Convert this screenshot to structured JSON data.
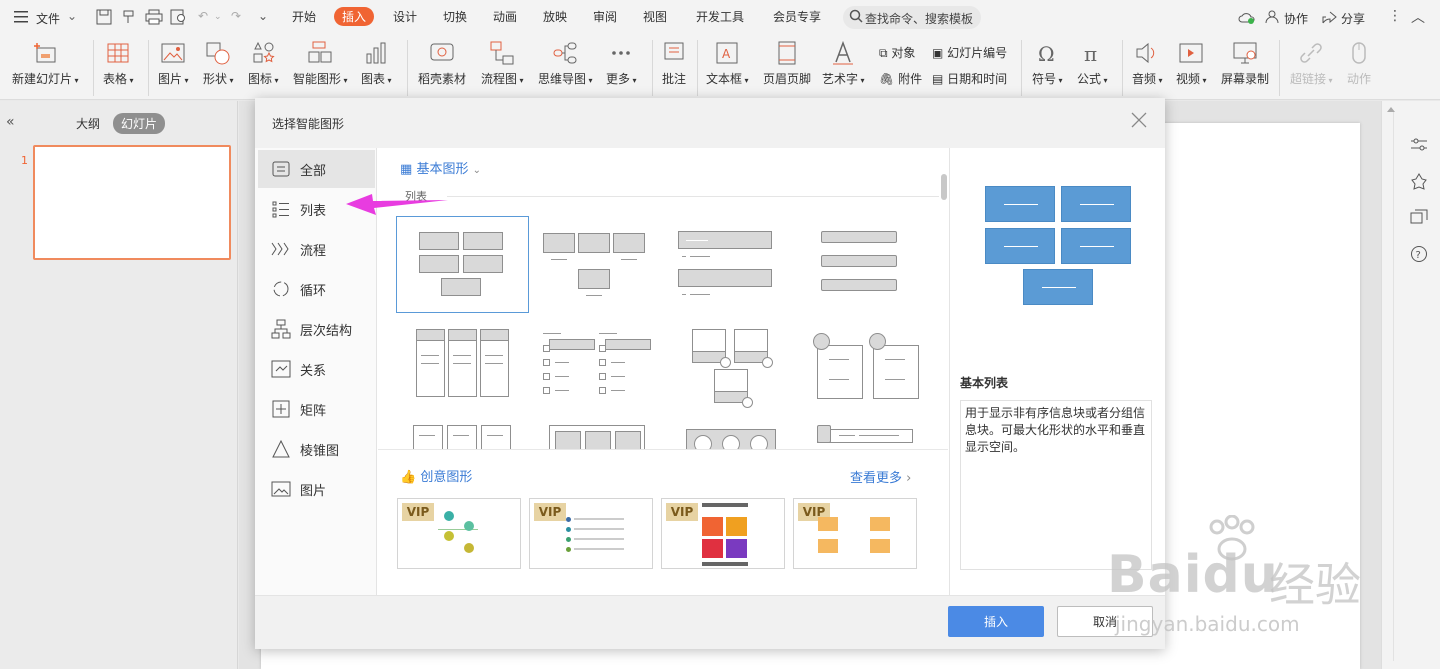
{
  "menu": {
    "file": "文件",
    "tabs": [
      "开始",
      "插入",
      "设计",
      "切换",
      "动画",
      "放映",
      "审阅",
      "视图",
      "开发工具",
      "会员专享"
    ],
    "active_tab": "插入",
    "search_placeholder": "查找命令、搜索模板",
    "collab": "协作",
    "share": "分享"
  },
  "ribbon": {
    "new_slide": "新建幻灯片",
    "table": "表格",
    "picture": "图片",
    "shape": "形状",
    "icon": "图标",
    "smart_art": "智能图形",
    "chart": "图表",
    "docer": "稻壳素材",
    "flowchart": "流程图",
    "mindmap": "思维导图",
    "more": "更多",
    "comment": "批注",
    "textbox": "文本框",
    "header_footer": "页眉页脚",
    "wordart": "艺术字",
    "object": "对象",
    "attachment": "附件",
    "slide_number": "幻灯片编号",
    "datetime": "日期和时间",
    "symbol": "符号",
    "formula": "公式",
    "audio": "音频",
    "video": "视频",
    "screen_rec": "屏幕录制",
    "hyperlink": "超链接",
    "action": "动作"
  },
  "left_panel": {
    "outline": "大纲",
    "slides": "幻灯片",
    "slide_no": "1"
  },
  "dialog": {
    "title": "选择智能图形",
    "categories": [
      {
        "label": "全部",
        "icon": "all-icon"
      },
      {
        "label": "列表",
        "icon": "list-icon"
      },
      {
        "label": "流程",
        "icon": "process-icon"
      },
      {
        "label": "循环",
        "icon": "cycle-icon"
      },
      {
        "label": "层次结构",
        "icon": "hierarchy-icon"
      },
      {
        "label": "关系",
        "icon": "relation-icon"
      },
      {
        "label": "矩阵",
        "icon": "matrix-icon"
      },
      {
        "label": "棱锥图",
        "icon": "pyramid-icon"
      },
      {
        "label": "图片",
        "icon": "picture-icon"
      }
    ],
    "active_category": "全部",
    "basic_shapes_label": "基本图形",
    "section_label": "列表",
    "creative_label": "创意图形",
    "see_more": "查看更多",
    "vip_badge": "VIP",
    "preview_title": "基本列表",
    "preview_desc": "用于显示非有序信息块或者分组信息块。可最大化形状的水平和垂直显示空间。",
    "insert_btn": "插入",
    "cancel_btn": "取消"
  },
  "watermark": {
    "text1": "Baidu",
    "text2": "经验",
    "url": "jingyan.baidu.com"
  },
  "colors": {
    "accent": "#f06433",
    "primary_btn": "#4b8ae5",
    "arrow": "#e83ce0",
    "preview_box": "#5b9bd5"
  }
}
